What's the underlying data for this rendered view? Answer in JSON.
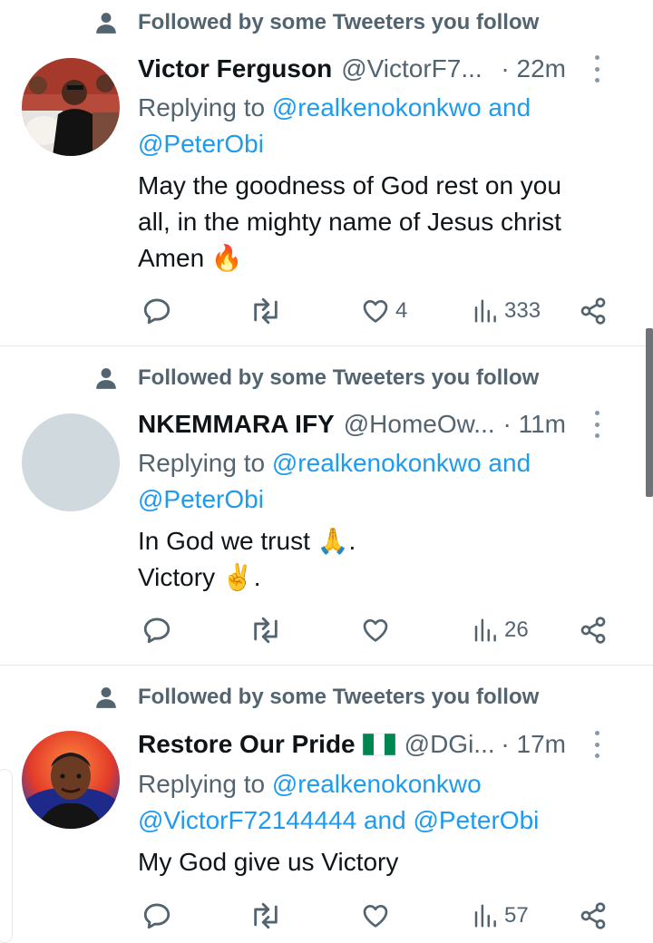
{
  "tweets": [
    {
      "social_context": "Followed by some Tweeters you follow",
      "name": "Victor Ferguson",
      "handle": "@VictorF7...",
      "time": "· 22m",
      "replying_prefix": "Replying to ",
      "replying_line1_mention": "@realkenokonkwo",
      "replying_line1_suffix": " and",
      "replying_line2": "@PeterObi",
      "text_lines": [
        "May the goodness of God rest on you",
        "all, in the mighty name of Jesus christ",
        "Amen 🔥"
      ],
      "likes": "4",
      "views": "333"
    },
    {
      "social_context": "Followed by some Tweeters you follow",
      "name": "NKEMMARA IFY",
      "handle": "@HomeOw...",
      "time": "· 11m",
      "replying_prefix": "Replying to ",
      "replying_line1_mention": "@realkenokonkwo",
      "replying_line1_suffix": " and",
      "replying_line2": "@PeterObi",
      "text_lines": [
        "In God we trust 🙏.",
        "Victory ✌️."
      ],
      "likes": "",
      "views": "26"
    },
    {
      "social_context": "Followed by some Tweeters you follow",
      "name": "Restore Our Pride",
      "handle": "@DGi...",
      "time": "· 17m",
      "replying_prefix": "Replying to ",
      "replying_line1_mention": "@realkenokonkwo",
      "replying_line1_suffix": "",
      "replying_line2_a": "@VictorF72144444",
      "replying_line2_and": " and ",
      "replying_line2_b": "@PeterObi",
      "text_lines": [
        "My God give us Victory"
      ],
      "likes": "",
      "views": "57"
    }
  ],
  "colors": {
    "primary_text": "#0f1419",
    "secondary_text": "#536471",
    "link": "#1d9bf0",
    "nigeria_green": "#008751"
  },
  "icons": [
    "person-icon",
    "more-icon",
    "reply-icon",
    "retweet-icon",
    "like-icon",
    "views-icon",
    "share-icon",
    "fire-emoji",
    "pray-emoji",
    "victory-emoji",
    "nigeria-flag-icon"
  ]
}
